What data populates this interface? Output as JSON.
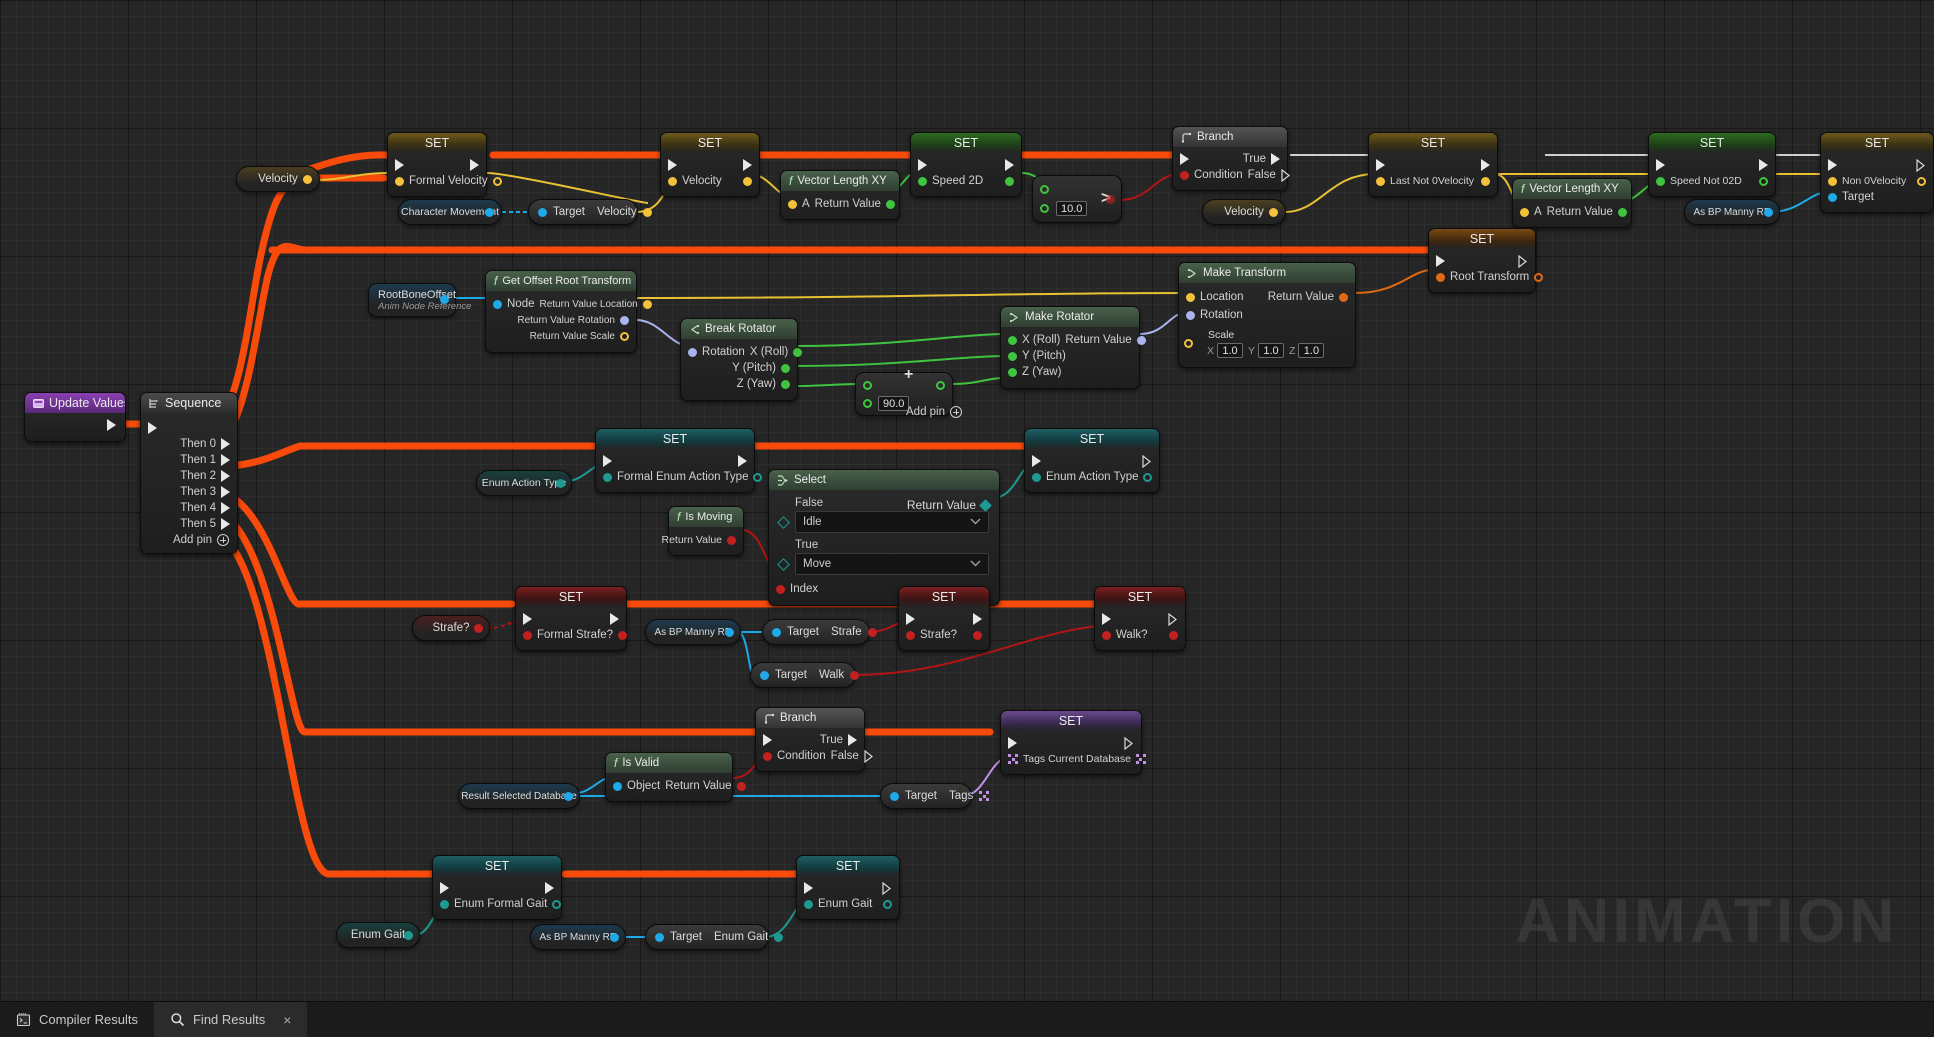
{
  "app": {
    "watermark": "ANIMATION"
  },
  "footer": {
    "tabs": [
      {
        "label": "Compiler Results",
        "icon": "compiler-icon",
        "active": false,
        "closable": false
      },
      {
        "label": "Find Results",
        "icon": "search-icon",
        "active": true,
        "closable": true,
        "close_label": "×"
      }
    ]
  },
  "nodes": {
    "update_values": {
      "title": "Update Values",
      "icon": "event-icon"
    },
    "sequence": {
      "title": "Sequence",
      "icon": "sequence-icon",
      "exec_in": "",
      "outputs": [
        "Then 0",
        "Then 1",
        "Then 2",
        "Then 3",
        "Then 4",
        "Then 5"
      ],
      "add_pin": "Add pin"
    },
    "get_velocity_1": {
      "label": "Velocity"
    },
    "set_formal_velocity": {
      "title": "SET",
      "pin": "Formal Velocity"
    },
    "character_movement": {
      "label": "Character Movement"
    },
    "target_velocity": {
      "target": "Target",
      "value": "Velocity"
    },
    "set_velocity": {
      "title": "SET",
      "pin": "Velocity"
    },
    "vector_length_xy_1": {
      "title": "Vector Length XY",
      "in": "A",
      "out": "Return Value"
    },
    "set_speed_2d": {
      "title": "SET",
      "pin": "Speed 2D"
    },
    "greater_node": {
      "op": ">",
      "value": "10.0"
    },
    "branch_top": {
      "title": "Branch",
      "condition": "Condition",
      "true": "True",
      "false": "False"
    },
    "get_velocity_2": {
      "label": "Velocity"
    },
    "set_last_not_0_velocity": {
      "title": "SET",
      "pin": "Last Not 0Velocity"
    },
    "vector_length_xy_2": {
      "title": "Vector Length XY",
      "in": "A",
      "out": "Return Value"
    },
    "set_speed_not_0_2d": {
      "title": "SET",
      "pin": "Speed Not 02D"
    },
    "as_bp_manny_top": {
      "label": "As BP Manny RE"
    },
    "set_non_0_velocity": {
      "title": "SET",
      "pin": "Non 0Velocity",
      "target": "Target"
    },
    "root_bone_offset": {
      "label": "RootBoneOffset",
      "sub": "Anim Node Reference"
    },
    "get_offset_root_transform": {
      "title": "Get Offset Root Transform",
      "in": "Node",
      "out_location": "Return Value Location",
      "out_rotation": "Return Value Rotation",
      "out_scale": "Return Value Scale"
    },
    "break_rotator": {
      "title": "Break Rotator",
      "in": "Rotation",
      "outs": [
        "X (Roll)",
        "Y (Pitch)",
        "Z (Yaw)"
      ]
    },
    "add_node": {
      "value": "90.0",
      "add_pin": "Add pin",
      "op": "+"
    },
    "make_rotator": {
      "title": "Make Rotator",
      "ins": [
        "X (Roll)",
        "Y (Pitch)",
        "Z (Yaw)"
      ],
      "out": "Return Value"
    },
    "make_transform": {
      "title": "Make Transform",
      "in_location": "Location",
      "in_rotation": "Rotation",
      "scale_label": "Scale",
      "scale_x_axis": "X",
      "scale_x": "1.0",
      "scale_y_axis": "Y",
      "scale_y": "1.0",
      "scale_z_axis": "Z",
      "scale_z": "1.0",
      "out": "Return Value"
    },
    "set_root_transform": {
      "title": "SET",
      "pin": "Root Transform"
    },
    "get_enum_action_type": {
      "label": "Enum Action Type"
    },
    "set_formal_enum_action_type": {
      "title": "SET",
      "pin": "Formal Enum Action Type"
    },
    "is_moving": {
      "title": "Is Moving",
      "out": "Return Value"
    },
    "select": {
      "title": "Select",
      "false_label": "False",
      "false_value": "Idle",
      "true_label": "True",
      "true_value": "Move",
      "index_label": "Index",
      "out": "Return Value"
    },
    "set_enum_action_type": {
      "title": "SET",
      "pin": "Enum Action Type"
    },
    "get_strafe": {
      "label": "Strafe?"
    },
    "set_formal_strafe": {
      "title": "SET",
      "pin": "Formal Strafe?"
    },
    "as_bp_manny_strafe": {
      "label": "As BP Manny RE"
    },
    "target_strafe": {
      "target": "Target",
      "value": "Strafe"
    },
    "target_walk": {
      "target": "Target",
      "value": "Walk"
    },
    "set_strafe": {
      "title": "SET",
      "pin": "Strafe?"
    },
    "set_walk": {
      "title": "SET",
      "pin": "Walk?"
    },
    "result_selected_database": {
      "label": "Result Selected Database"
    },
    "is_valid": {
      "title": "Is Valid",
      "in": "Object",
      "out": "Return Value"
    },
    "branch_tags": {
      "title": "Branch",
      "condition": "Condition",
      "true": "True",
      "false": "False"
    },
    "target_tags": {
      "target": "Target",
      "value": "Tags"
    },
    "set_tags_current_database": {
      "title": "SET",
      "pin": "Tags Current Database"
    },
    "get_enum_gait": {
      "label": "Enum Gait"
    },
    "set_enum_formal_gait": {
      "title": "SET",
      "pin": "Enum Formal Gait"
    },
    "as_bp_manny_gait": {
      "label": "As BP Manny RE"
    },
    "target_enum_gait": {
      "target": "Target",
      "value": "Enum Gait"
    },
    "set_enum_gait": {
      "title": "SET",
      "pin": "Enum Gait"
    }
  },
  "colors": {
    "exec_wire": "#f84a0a",
    "float_wire": "#3fc43f",
    "vector_wire": "#e8c233",
    "bool_wire": "#b31515",
    "object_wire": "#1fa9e8",
    "rotator_wire": "#a9b4ef",
    "transform_wire": "#e06a13",
    "enum_wire": "#1e9a92",
    "struct_wire": "#c38fe8",
    "white_wire": "#cfcfcf",
    "event_header": "#8a3fb0"
  }
}
